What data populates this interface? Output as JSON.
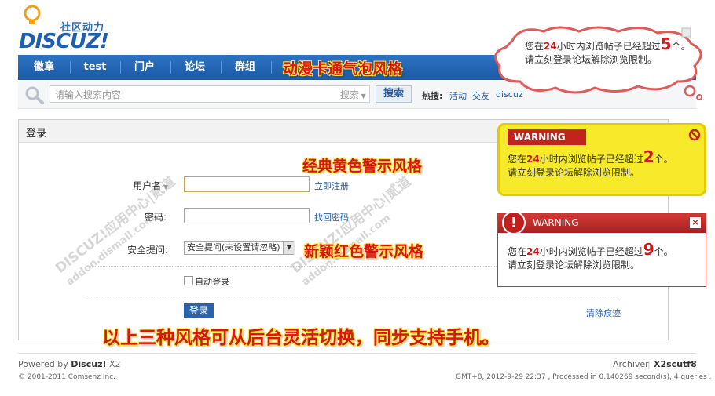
{
  "logo": {
    "slogan": "社区动力",
    "text": "DISCUZ!"
  },
  "nav": {
    "items": [
      "徽章",
      "test",
      "门户",
      "论坛",
      "群组"
    ]
  },
  "search": {
    "placeholder": "请输入搜索内容",
    "type_label": "搜索",
    "button_label": "搜索",
    "hot_label": "热搜:",
    "hot_links": [
      "活动",
      "交友",
      "discuz"
    ]
  },
  "login": {
    "title": "登录",
    "username_label": "用户名",
    "register_link": "立即注册",
    "password_label": "密码:",
    "forgot_link": "找回密码",
    "question_label": "安全提问:",
    "question_value": "安全提问(未设置请忽略)",
    "auto_login": "自动登录",
    "submit_label": "登录",
    "clear_link": "清除痕迹"
  },
  "captions": {
    "cartoon": "动漫卡通气泡风格",
    "yellow": "经典黄色警示风格",
    "red": "新颖红色警示风格",
    "bottom": "以上三种风格可从后台灵活切换，同步支持手机。"
  },
  "bubble": {
    "line1_pre": "您在",
    "hours": "24",
    "line1_mid": "小时内浏览帖子已经超过",
    "count": "5",
    "line1_post": "个。",
    "line2": "请立刻登录论坛解除浏览限制。"
  },
  "yellow_warning": {
    "badge": "WARNING",
    "line1_pre": "您在",
    "hours": "24",
    "line1_mid": "小时内浏览帖子已经超过",
    "count": "2",
    "line1_post": "个。",
    "line2": "请立刻登录论坛解除浏览限制。"
  },
  "red_warning": {
    "title": "WARNING",
    "close": "×",
    "badge": "!",
    "line1_pre": "您在",
    "hours": "24",
    "line1_mid": "小时内浏览帖子已经超过",
    "count": "9",
    "line1_post": "个。",
    "line2": "请立刻登录论坛解除浏览限制。"
  },
  "footer": {
    "powered_pre": "Powered by ",
    "powered_brand": "Discuz!",
    "powered_ver": " X2",
    "copyright": "© 2001-2011 Comsenz Inc.",
    "archiver": "Archiver",
    "site_code": "X2scutf8",
    "gmt": "GMT+8, 2012-9-29 22:37 , Processed in 0.140269 second(s), 4 queries ."
  },
  "watermark": {
    "line1": "DISCUZ!应用中心|贰道",
    "line2": "addon.dismall.com"
  },
  "colors": {
    "nav": "#1f63b3",
    "caption": "#d9131a",
    "yellow": "#f6ea2a",
    "red": "#c0241b"
  }
}
